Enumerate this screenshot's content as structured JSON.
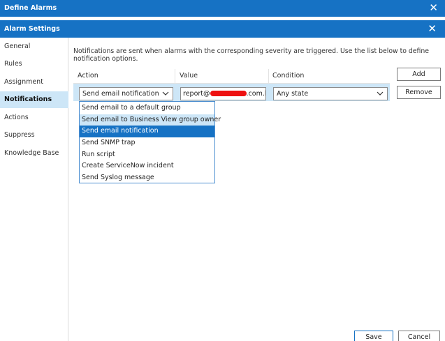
{
  "window": {
    "title": "Define Alarms",
    "close_glyph": "✕"
  },
  "dialog": {
    "title": "Alarm Settings",
    "close_glyph": "✕"
  },
  "sidebar": {
    "items": [
      {
        "label": "General"
      },
      {
        "label": "Rules"
      },
      {
        "label": "Assignment"
      },
      {
        "label": "Notifications",
        "selected": true
      },
      {
        "label": "Actions"
      },
      {
        "label": "Suppress"
      },
      {
        "label": "Knowledge Base"
      }
    ]
  },
  "main": {
    "description": "Notifications are sent when alarms with the corresponding severity are triggered. Use the list below to define notification options.",
    "columns": {
      "action": "Action",
      "value": "Value",
      "condition": "Condition"
    },
    "row": {
      "action": "Send email notification",
      "value_prefix": "report@",
      "value_suffix": ".com.b",
      "condition": "Any state"
    },
    "buttons": {
      "add": "Add",
      "remove": "Remove"
    },
    "dropdown": {
      "options": [
        "Send email to a default group",
        "Send email to Business View group owner",
        "Send email notification",
        "Send SNMP trap",
        "Run script",
        "Create ServiceNow incident",
        "Send Syslog message"
      ],
      "hovered_index": 1,
      "selected_index": 2
    }
  },
  "footer": {
    "save": "Save",
    "cancel": "Cancel"
  },
  "colors": {
    "accent": "#1672c4",
    "selection": "#cde6f7",
    "redaction": "#ee1111"
  },
  "icons": {
    "close": "close-icon",
    "dropdown": "chevron-down-icon"
  }
}
